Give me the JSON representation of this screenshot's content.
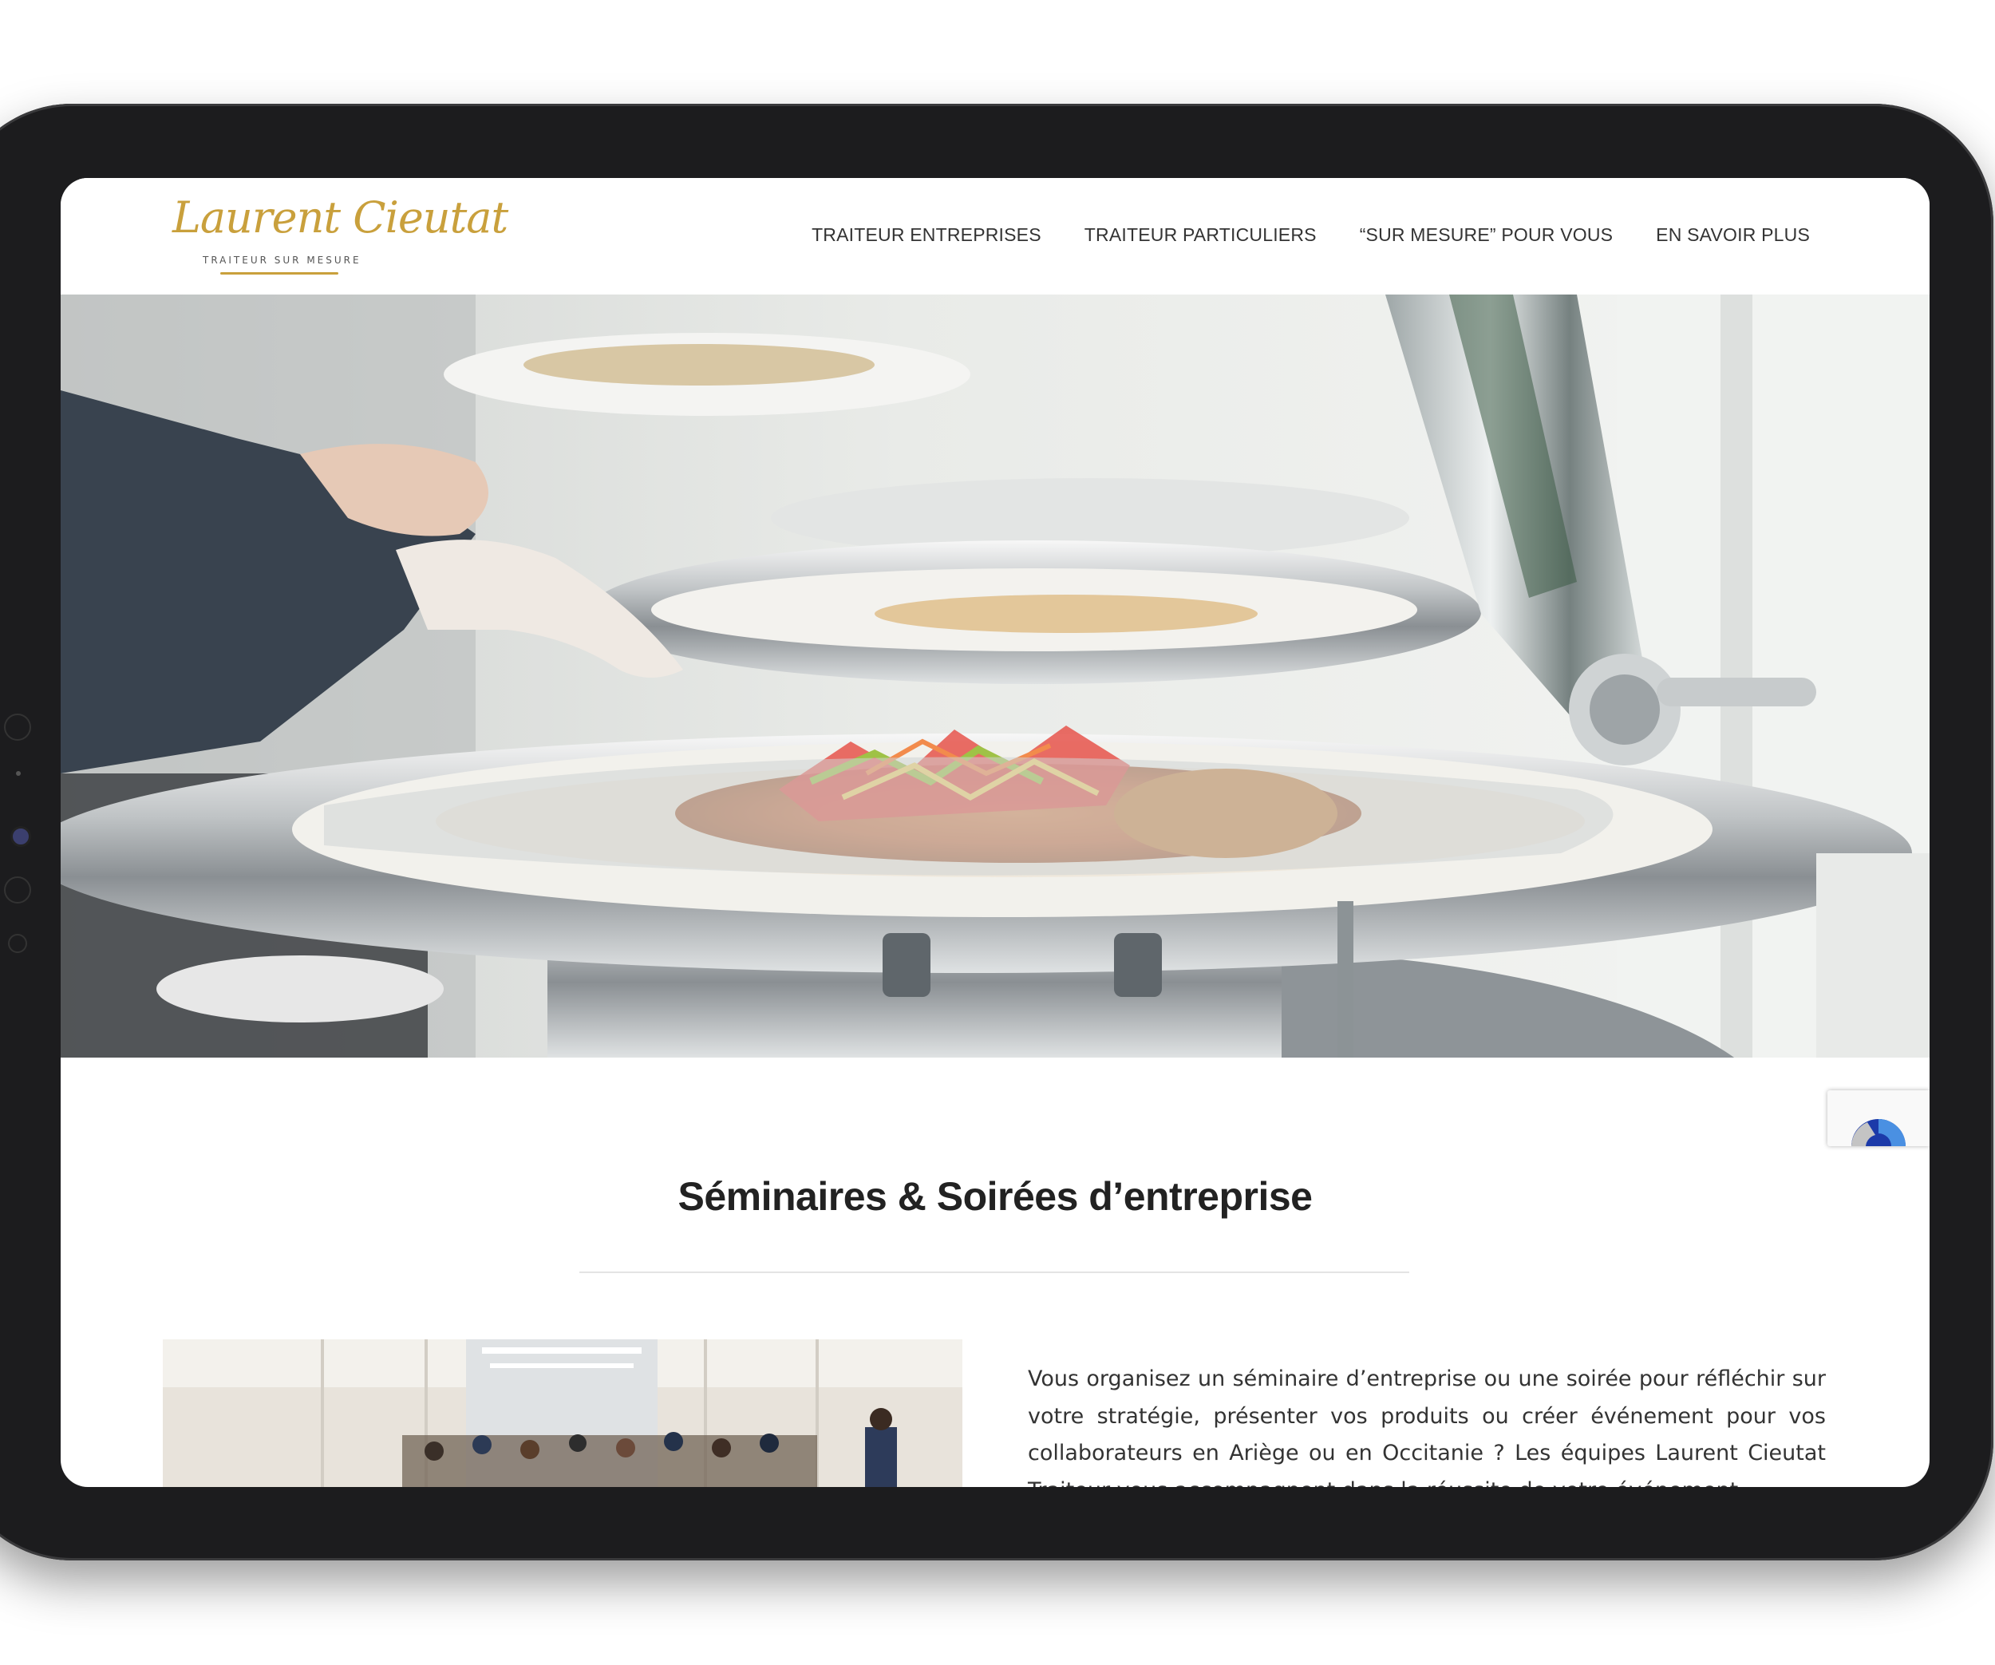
{
  "brand": {
    "logo_script": "Laurent Cieutat",
    "logo_tagline": "TRAITEUR SUR MESURE",
    "accent_color": "#c9a03c"
  },
  "nav": {
    "items": [
      {
        "label": "TRAITEUR ENTREPRISES"
      },
      {
        "label": "TRAITEUR PARTICULIERS"
      },
      {
        "label": "“SUR MESURE” POUR VOUS"
      },
      {
        "label": "EN SAVOIR PLUS"
      }
    ]
  },
  "main": {
    "title": "Séminaires & Soirées d’entreprise",
    "intro": "Vous organisez un séminaire d’entreprise ou une soirée pour réfléchir sur votre stratégie, présenter vos produits  ou créer événement pour vos collaborateurs en Ariège ou en Occitanie ? Les équipes Laurent Cieutat Traiteur vous accompagnent dans la réussite de votre événement."
  },
  "icons": {
    "recaptcha": "recaptcha-icon"
  }
}
